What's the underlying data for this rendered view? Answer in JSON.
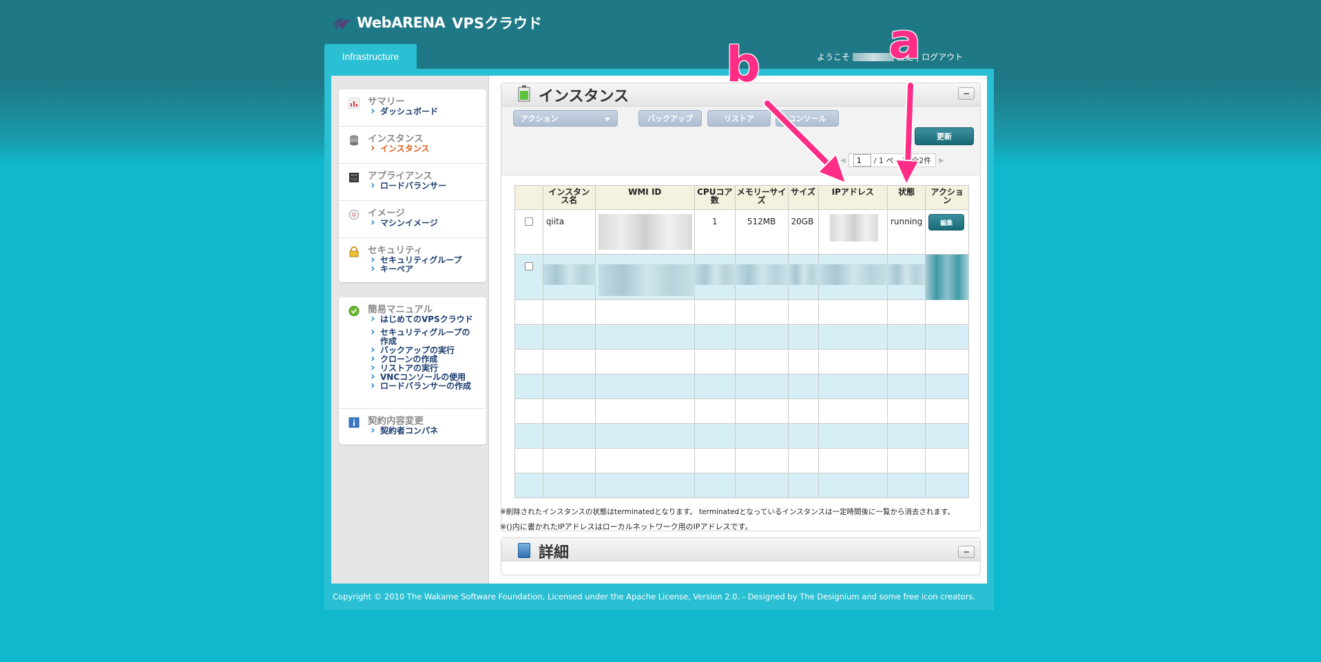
{
  "header": {
    "brand": "WebARENA",
    "product": "VPSクラウド",
    "tab": "Infrastructure",
    "welcome": "ようこそ",
    "settings": "設定",
    "separator": "|",
    "logout": "ログアウト"
  },
  "sidebar": {
    "sections": [
      {
        "title": "サマリー",
        "icon": "chart-icon",
        "links": [
          "ダッシュボード"
        ]
      },
      {
        "title": "インスタンス",
        "icon": "database-icon",
        "links": [
          "インスタンス"
        ],
        "active": "インスタンス"
      },
      {
        "title": "アプライアンス",
        "icon": "appliance-icon",
        "links": [
          "ロードバランサー"
        ]
      },
      {
        "title": "イメージ",
        "icon": "disc-icon",
        "links": [
          "マシンイメージ"
        ]
      },
      {
        "title": "セキュリティ",
        "icon": "lock-icon",
        "links": [
          "セキュリティグループ",
          "キーペア"
        ]
      }
    ],
    "manual": {
      "title": "簡易マニュアル",
      "icon": "check-circle-icon",
      "links": [
        "はじめてのVPSクラウド",
        "セキュリティグループの作成",
        "バックアップの実行",
        "クローンの作成",
        "リストアの実行",
        "VNCコンソールの使用",
        "ロードバランサーの作成"
      ]
    },
    "contract": {
      "title": "契約内容変更",
      "icon": "info-icon",
      "links": [
        "契約者コンパネ"
      ]
    }
  },
  "main": {
    "title": "インスタンス",
    "collapse": "−",
    "toolbar": {
      "action": "アクション",
      "backup": "バックアップ",
      "restore": "リストア",
      "console": "コンソール",
      "refresh": "更新"
    },
    "pager": {
      "prev": "◀",
      "page": "1",
      "of": "/ 1 ページ",
      "total": "全2件",
      "next": "▶"
    },
    "table": {
      "headers": [
        "",
        "インスタンス名",
        "WMI ID",
        "CPUコア数",
        "メモリーサイズ",
        "サイズ",
        "IPアドレス",
        "状態",
        "アクション"
      ],
      "rows": [
        {
          "name": "qiita",
          "cpu": "1",
          "memory": "512MB",
          "size": "20GB",
          "state": "running",
          "action": "編集"
        }
      ]
    },
    "notes": [
      "※削除されたインスタンスの状態はterminatedとなります。 terminatedとなっているインスタンスは一定時間後に一覧から消去されます。",
      "※()内に書かれたIPアドレスはローカルネットワーク用のIPアドレスです。"
    ]
  },
  "detail": {
    "title": "詳細",
    "collapse": "−"
  },
  "footer": {
    "text": "Copyright © 2010 The Wakame Software Foundation, Licensed under the Apache License, Version 2.0. - Designed by The Designium and some free icon creators."
  },
  "annotations": {
    "a": "a",
    "b": "b"
  },
  "colors": {
    "accent": "#186a77",
    "annotation": "#ff2d86",
    "active_link": "#d95b1a"
  }
}
